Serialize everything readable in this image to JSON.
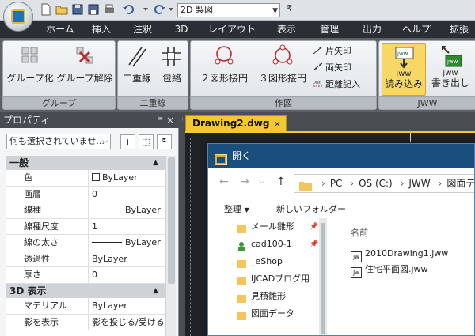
{
  "qat": {
    "workspace": "2D 製図"
  },
  "tabs": [
    "ホーム",
    "挿入",
    "注釈",
    "3D",
    "レイアウト",
    "表示",
    "管理",
    "出力",
    "ヘルプ",
    "拡張"
  ],
  "ribbon": {
    "group_group": {
      "label": "グループ",
      "btn1": "グループ化",
      "btn2": "グループ解除"
    },
    "group_dline": {
      "label": "二重線",
      "btn1": "二重線",
      "btn2": "包絡"
    },
    "group_draw": {
      "label": "作図",
      "btn1": "２図形接円",
      "btn2": "３図形接円",
      "small1": "片矢印",
      "small2": "両矢印",
      "small3": "距離記入"
    },
    "group_jww": {
      "label": "JWW",
      "btn1_line1": "jww",
      "btn1_line2": "読み込み",
      "btn2_line1": "jww",
      "btn2_line2": "書き出し",
      "icon_text": "jww"
    }
  },
  "props": {
    "title": "プロパティ",
    "selection": "何も選択されていませ...",
    "categories": {
      "general": "一般",
      "display3d": "3D 表示"
    },
    "rows": [
      {
        "name": "色",
        "value": "ByLayer"
      },
      {
        "name": "画層",
        "value": "0"
      },
      {
        "name": "線種",
        "value": "ByLayer"
      },
      {
        "name": "線種尺度",
        "value": "1"
      },
      {
        "name": "線の太さ",
        "value": "ByLayer"
      },
      {
        "name": "透過性",
        "value": "ByLayer"
      },
      {
        "name": "厚さ",
        "value": "0"
      }
    ],
    "rows3d": [
      {
        "name": "マテリアル",
        "value": "ByLayer"
      },
      {
        "name": "影を表示",
        "value": "影を投じる/受ける"
      }
    ]
  },
  "doc": {
    "tab": "Drawing2.dwg"
  },
  "dialog": {
    "title": "開く",
    "path": [
      "PC",
      "OS (C:)",
      "JWW",
      "図面データ"
    ],
    "organize": "整理",
    "new_folder": "新しいフォルダー",
    "col_name": "名前",
    "nav_items": [
      "メール雛形",
      "cad100-1",
      "_eShop",
      "IJCADブログ用",
      "見積雛形",
      "図面データ"
    ],
    "files": [
      "2010Drawing1.jww",
      "住宅平面図.jww"
    ],
    "file_icon_text": "Jw"
  }
}
